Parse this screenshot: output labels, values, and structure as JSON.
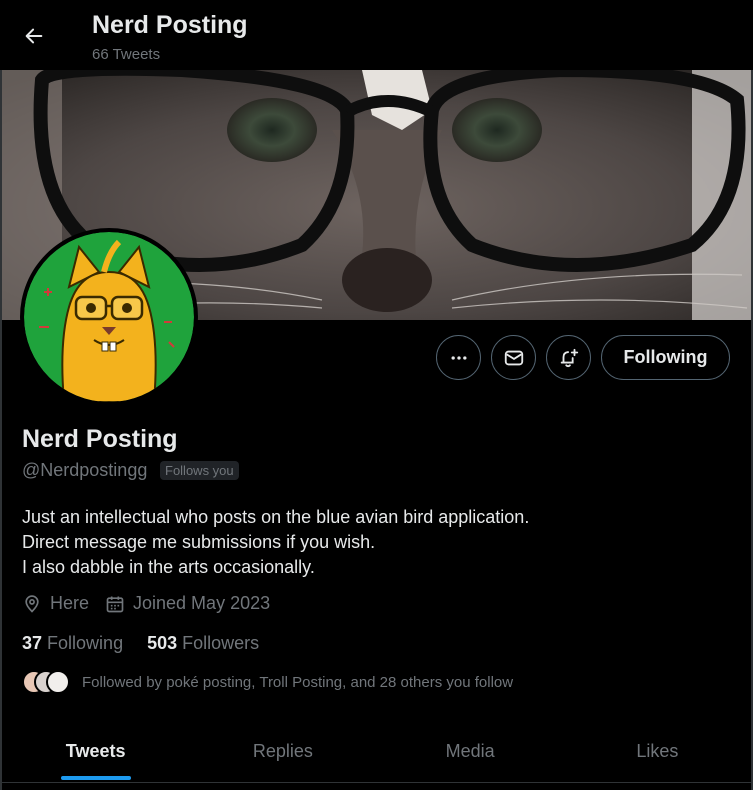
{
  "header": {
    "title": "Nerd Posting",
    "tweet_count": "66 Tweets"
  },
  "actions": {
    "more_icon": "more-icon",
    "message_icon": "envelope-icon",
    "notify_icon": "bell-plus-icon",
    "following_label": "Following"
  },
  "profile": {
    "name": "Nerd Posting",
    "handle": "@Nerdpostingg",
    "follows_you": "Follows you",
    "bio": [
      "Just an intellectual who posts on the blue avian bird application.",
      "Direct message me submissions if you wish.",
      "I also dabble in the arts occasionally."
    ],
    "location": "Here",
    "joined": "Joined May 2023",
    "following_count": "37",
    "following_label": "Following",
    "followers_count": "503",
    "followers_label": "Followers",
    "followed_by": "Followed by poké posting, Troll Posting, and 28 others you follow"
  },
  "tabs": [
    {
      "label": "Tweets",
      "active": true
    },
    {
      "label": "Replies",
      "active": false
    },
    {
      "label": "Media",
      "active": false
    },
    {
      "label": "Likes",
      "active": false
    }
  ],
  "colors": {
    "background": "#000000",
    "text_primary": "#e7e9ea",
    "text_secondary": "#71767b",
    "accent": "#1d9bf0",
    "border": "#2f3336"
  }
}
